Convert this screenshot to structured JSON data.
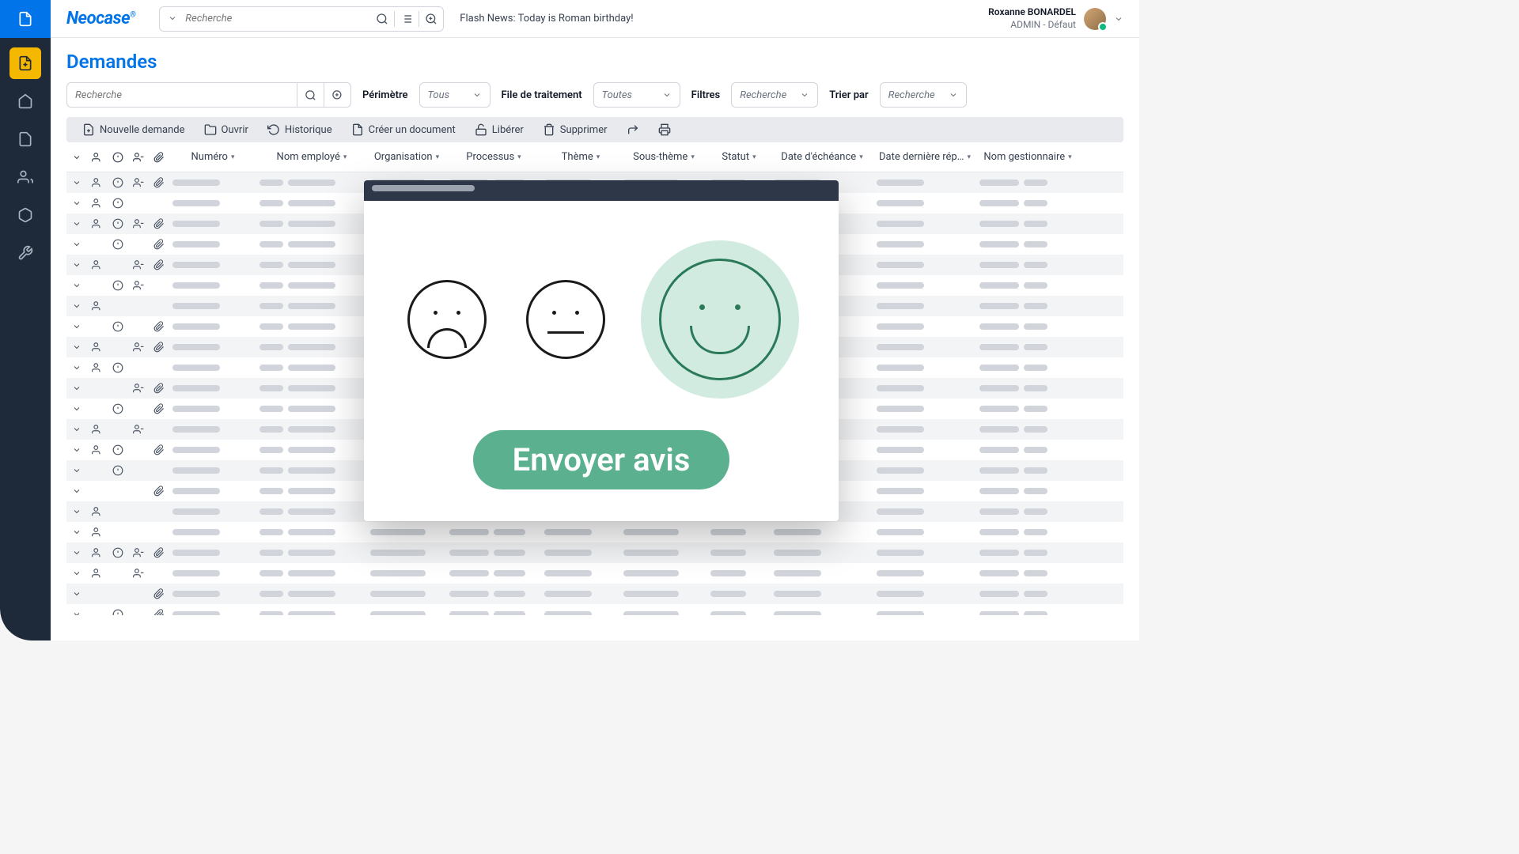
{
  "logo": "Neocase",
  "header": {
    "search_placeholder": "Recherche",
    "flash_news": "Flash News: Today is Roman birthday!",
    "user_name": "Roxanne  BONARDEL",
    "user_role": "ADMIN - Défaut"
  },
  "page": {
    "title": "Demandes"
  },
  "filters": {
    "search_placeholder": "Recherche",
    "perimetre_label": "Périmètre",
    "perimetre_value": "Tous",
    "file_label": "File de traitement",
    "file_value": "Toutes",
    "filtres_label": "Filtres",
    "filtres_value": "Recherche",
    "trier_label": "Trier par",
    "trier_value": "Recherche"
  },
  "toolbar": {
    "new_request": "Nouvelle demande",
    "open": "Ouvrir",
    "history": "Historique",
    "create_doc": "Créer un document",
    "release": "Libérer",
    "delete": "Supprimer"
  },
  "columns": {
    "numero": "Numéro",
    "nom_employe": "Nom employé",
    "organisation": "Organisation",
    "processus": "Processus",
    "theme": "Thème",
    "sous_theme": "Sous-thème",
    "statut": "Statut",
    "date_echeance": "Date d'échéance",
    "date_derniere": "Date dernière rép…",
    "nom_gestionnaire": "Nom gestionnaire"
  },
  "modal": {
    "send_button": "Envoyer avis"
  },
  "rows": [
    {
      "icons": [
        "chev",
        "users",
        "alert",
        "user-minus",
        "clip"
      ]
    },
    {
      "icons": [
        "chev",
        "users",
        "alert",
        "",
        ""
      ]
    },
    {
      "icons": [
        "chev",
        "users",
        "alert",
        "user-minus",
        "clip"
      ]
    },
    {
      "icons": [
        "chev",
        "",
        "alert",
        "",
        "clip"
      ]
    },
    {
      "icons": [
        "chev",
        "users",
        "",
        "user-minus",
        "clip"
      ]
    },
    {
      "icons": [
        "chev",
        "",
        "alert",
        "user-minus",
        ""
      ]
    },
    {
      "icons": [
        "chev",
        "users",
        "",
        "",
        ""
      ]
    },
    {
      "icons": [
        "chev",
        "",
        "alert",
        "",
        "clip"
      ]
    },
    {
      "icons": [
        "chev",
        "users",
        "",
        "user-minus",
        "clip"
      ]
    },
    {
      "icons": [
        "chev",
        "users",
        "alert",
        "",
        ""
      ]
    },
    {
      "icons": [
        "chev",
        "",
        "",
        "user-minus",
        "clip"
      ]
    },
    {
      "icons": [
        "chev",
        "",
        "alert",
        "",
        "clip"
      ]
    },
    {
      "icons": [
        "chev",
        "users",
        "",
        "user-minus",
        ""
      ]
    },
    {
      "icons": [
        "chev",
        "users",
        "alert",
        "",
        "clip"
      ]
    },
    {
      "icons": [
        "chev",
        "",
        "alert",
        "",
        ""
      ]
    },
    {
      "icons": [
        "chev",
        "",
        "",
        "",
        "clip"
      ]
    },
    {
      "icons": [
        "chev",
        "users",
        "",
        "",
        ""
      ]
    },
    {
      "icons": [
        "chev",
        "users",
        "",
        "",
        ""
      ]
    },
    {
      "icons": [
        "chev",
        "users",
        "alert",
        "user-minus",
        "clip"
      ]
    },
    {
      "icons": [
        "chev",
        "users",
        "",
        "user-minus",
        ""
      ]
    },
    {
      "icons": [
        "chev",
        "",
        "",
        "",
        "clip"
      ]
    },
    {
      "icons": [
        "chev",
        "",
        "alert",
        "",
        "clip"
      ]
    },
    {
      "icons": [
        "chev",
        "users",
        "alert",
        "user-minus",
        ""
      ]
    }
  ]
}
